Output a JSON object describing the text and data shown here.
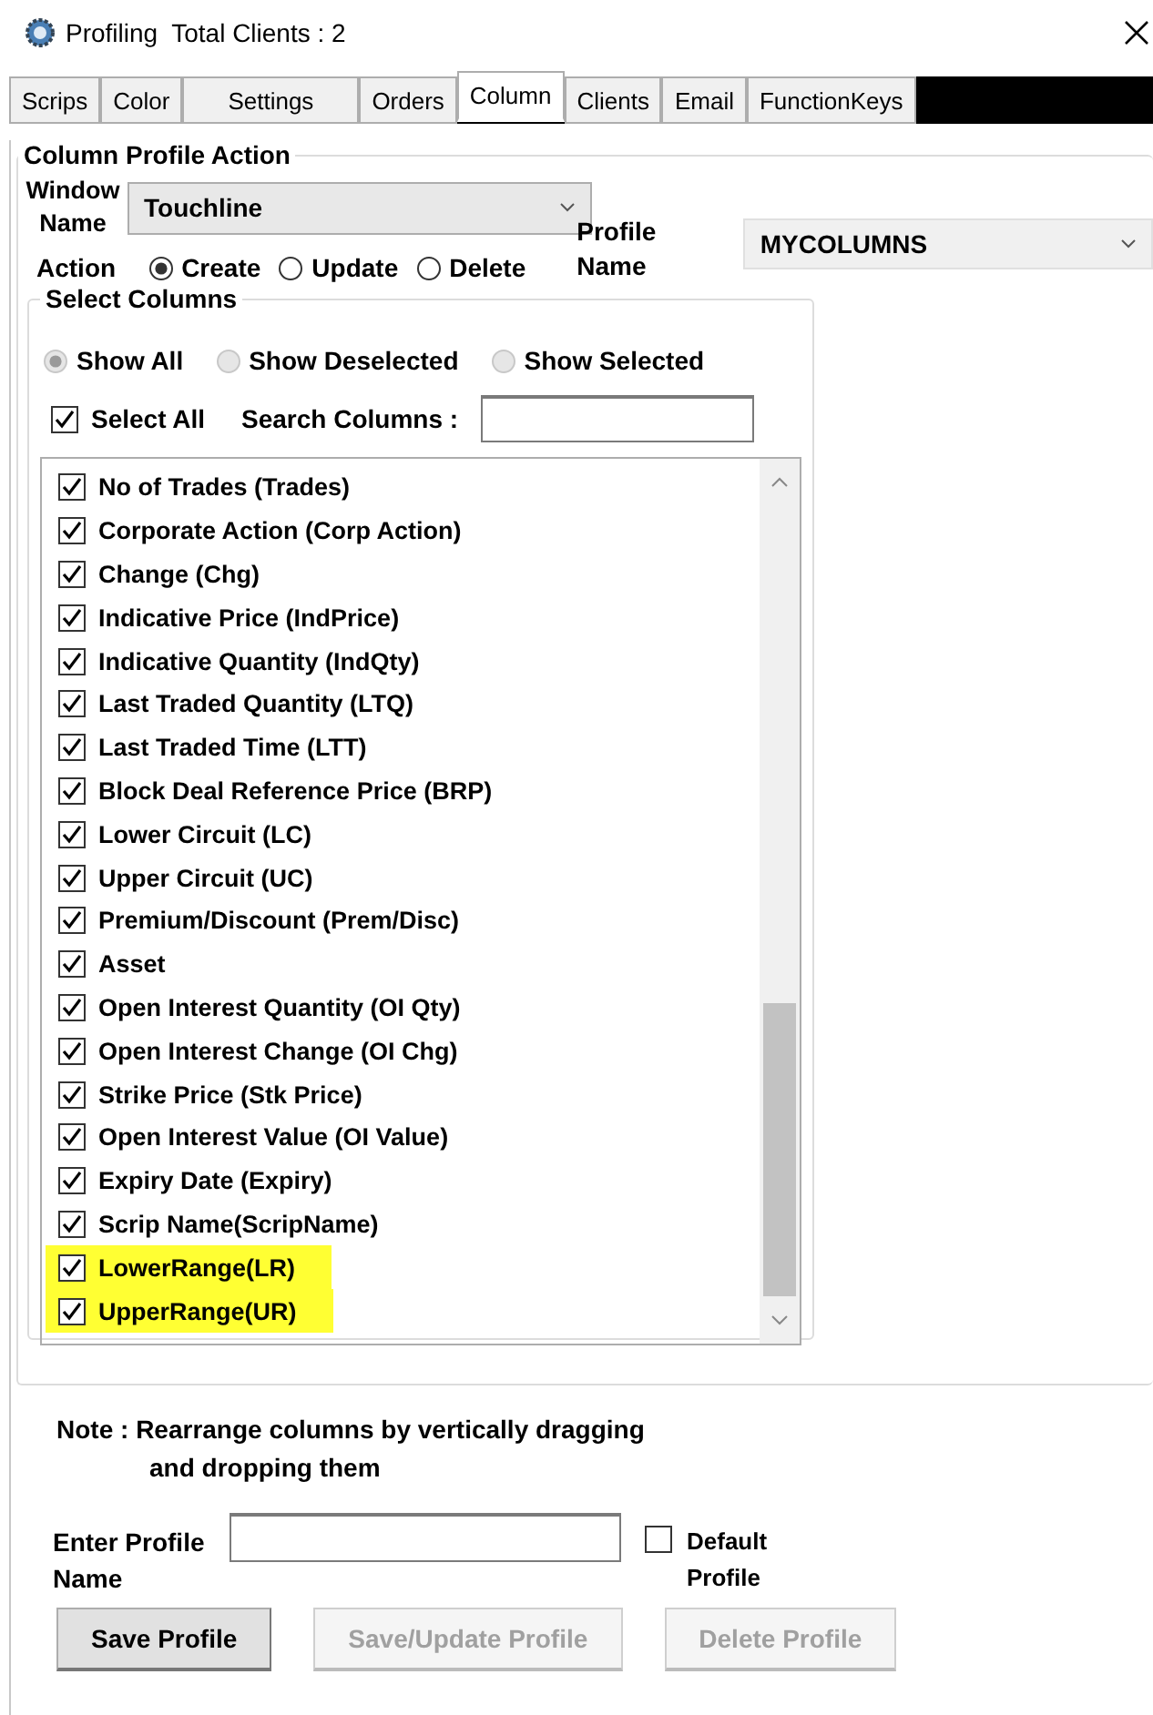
{
  "window": {
    "title": "Profiling  Total Clients : 2"
  },
  "tabs": [
    {
      "label": "Scrips",
      "selected": false
    },
    {
      "label": "Color",
      "selected": false
    },
    {
      "label": "Settings",
      "selected": false
    },
    {
      "label": "Orders",
      "selected": false
    },
    {
      "label": "Column",
      "selected": true
    },
    {
      "label": "Clients",
      "selected": false
    },
    {
      "label": "Email",
      "selected": false
    },
    {
      "label": "FunctionKeys",
      "selected": false
    }
  ],
  "profile_action": {
    "title": "Column Profile Action",
    "window_name_label": "Window Name",
    "window_name": "Touchline",
    "action_label": "Action",
    "actions": [
      {
        "label": "Create",
        "selected": true
      },
      {
        "label": "Update",
        "selected": false
      },
      {
        "label": "Delete",
        "selected": false
      }
    ],
    "profile_name_label": "Profile Name",
    "profile_name": "MYCOLUMNS",
    "select_columns": {
      "title": "Select Columns",
      "filters": [
        {
          "label": "Show All",
          "selected": true
        },
        {
          "label": "Show Deselected",
          "selected": false
        },
        {
          "label": "Show Selected",
          "selected": false
        }
      ],
      "select_all": {
        "label": "Select All",
        "checked": true
      },
      "search_label": "Search Columns :",
      "columns": [
        {
          "label": "No of Trades (Trades)",
          "checked": true,
          "highlighted": false
        },
        {
          "label": "Corporate Action (Corp Action)",
          "checked": true,
          "highlighted": false
        },
        {
          "label": "Change (Chg)",
          "checked": true,
          "highlighted": false
        },
        {
          "label": "Indicative Price (IndPrice)",
          "checked": true,
          "highlighted": false
        },
        {
          "label": "Indicative Quantity (IndQty)",
          "checked": true,
          "highlighted": false
        },
        {
          "label": "Last Traded Quantity (LTQ)",
          "checked": true,
          "highlighted": false
        },
        {
          "label": "Last Traded Time (LTT)",
          "checked": true,
          "highlighted": false
        },
        {
          "label": "Block Deal Reference Price (BRP)",
          "checked": true,
          "highlighted": false
        },
        {
          "label": "Lower Circuit (LC)",
          "checked": true,
          "highlighted": false
        },
        {
          "label": "Upper Circuit (UC)",
          "checked": true,
          "highlighted": false
        },
        {
          "label": "Premium/Discount (Prem/Disc)",
          "checked": true,
          "highlighted": false
        },
        {
          "label": "Asset",
          "checked": true,
          "highlighted": false
        },
        {
          "label": "Open Interest Quantity (OI Qty)",
          "checked": true,
          "highlighted": false
        },
        {
          "label": "Open Interest Change (OI Chg)",
          "checked": true,
          "highlighted": false
        },
        {
          "label": "Strike Price (Stk Price)",
          "checked": true,
          "highlighted": false
        },
        {
          "label": "Open Interest Value (OI Value)",
          "checked": true,
          "highlighted": false
        },
        {
          "label": "Expiry Date (Expiry)",
          "checked": true,
          "highlighted": false
        },
        {
          "label": "Scrip Name(ScripName)",
          "checked": true,
          "highlighted": false
        },
        {
          "label": "LowerRange(LR)",
          "checked": true,
          "highlighted": true
        },
        {
          "label": "UpperRange(UR)",
          "checked": true,
          "highlighted": true
        }
      ]
    },
    "note_label": "Note :",
    "note": "Rearrange columns by vertically dragging",
    "note_cont": "and dropping them",
    "enter_profile_label": "Enter Profile Name",
    "default_profile": {
      "label": "Default Profile",
      "checked": false
    },
    "buttons": [
      {
        "label": "Save Profile",
        "disabled": false
      },
      {
        "label": "Save/Update Profile",
        "disabled": true
      },
      {
        "label": "Delete Profile",
        "disabled": true
      }
    ]
  }
}
